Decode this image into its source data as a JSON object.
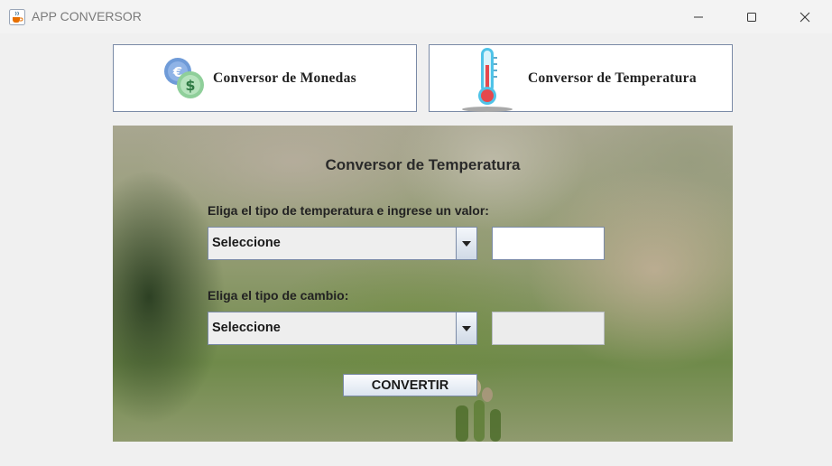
{
  "window": {
    "title": "APP CONVERSOR",
    "icon": "java-cup-icon",
    "controls": [
      "minimize-icon",
      "maximize-icon",
      "close-icon"
    ]
  },
  "mode_buttons": {
    "monedas": {
      "label": "Conversor de Monedas",
      "icon": "currency-coins-icon"
    },
    "temperatura": {
      "label": "Conversor de Temperatura",
      "icon": "thermometer-icon"
    }
  },
  "panel": {
    "title": "Conversor de Temperatura",
    "input_label": "Eliga el tipo de temperatura e ingrese un valor:",
    "from_select": {
      "value": "Seleccione"
    },
    "input_value": "",
    "output_label": "Eliga el tipo de cambio:",
    "to_select": {
      "value": "Seleccione"
    },
    "output_value": "",
    "convert_label": "CONVERTIR"
  },
  "colors": {
    "border": "#7a8aa6",
    "coin_blue": "#6f9bd8",
    "coin_green": "#8fcf9a",
    "thermo_red": "#e5484d",
    "thermo_cyan": "#4fc3e8"
  }
}
